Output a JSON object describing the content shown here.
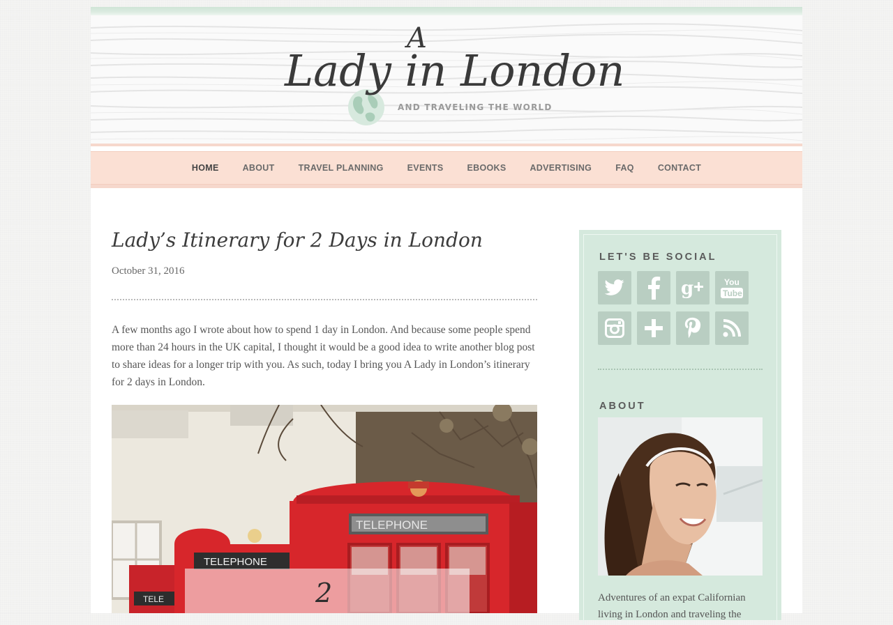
{
  "header": {
    "logo_a": "A",
    "logo_main": "Lady in London",
    "tagline": "AND TRAVELING THE WORLD"
  },
  "nav": {
    "items": [
      {
        "label": "HOME",
        "active": true
      },
      {
        "label": "ABOUT"
      },
      {
        "label": "TRAVEL PLANNING"
      },
      {
        "label": "EVENTS"
      },
      {
        "label": "EBOOKS"
      },
      {
        "label": "ADVERTISING"
      },
      {
        "label": "FAQ"
      },
      {
        "label": "CONTACT"
      }
    ]
  },
  "post": {
    "title": "Lady’s Itinerary for 2 Days in London",
    "date": "October 31, 2016",
    "body": "A few months ago I wrote about how to spend 1 day in London. And because some people spend more than 24 hours in the UK capital, I thought it would be a good idea to write another blog post to share ideas for a longer trip with you. As such, today I bring you A Lady in London’s itinerary for 2 days in London.",
    "image": {
      "sign_text_1": "TELEPHONE",
      "sign_text_2": "TELEPHONE",
      "sign_text_3": "TELE",
      "overlay_number": "2"
    }
  },
  "sidebar": {
    "social": {
      "title": "LET'S BE SOCIAL",
      "icons": [
        "twitter-icon",
        "facebook-icon",
        "google-plus-icon",
        "youtube-icon",
        "instagram-icon",
        "bloglovin-icon",
        "pinterest-icon",
        "rss-icon"
      ],
      "youtube_top": "You",
      "youtube_bottom": "Tube"
    },
    "about": {
      "title": "ABOUT",
      "text": "Adventures of an expat Californian living in London and traveling the"
    }
  },
  "colors": {
    "nav_bg": "#fbe0d4",
    "sidebar_bg": "#d5e9dd",
    "social_icon_bg": "#b9cec2",
    "phone_box_red": "#d7262b"
  }
}
